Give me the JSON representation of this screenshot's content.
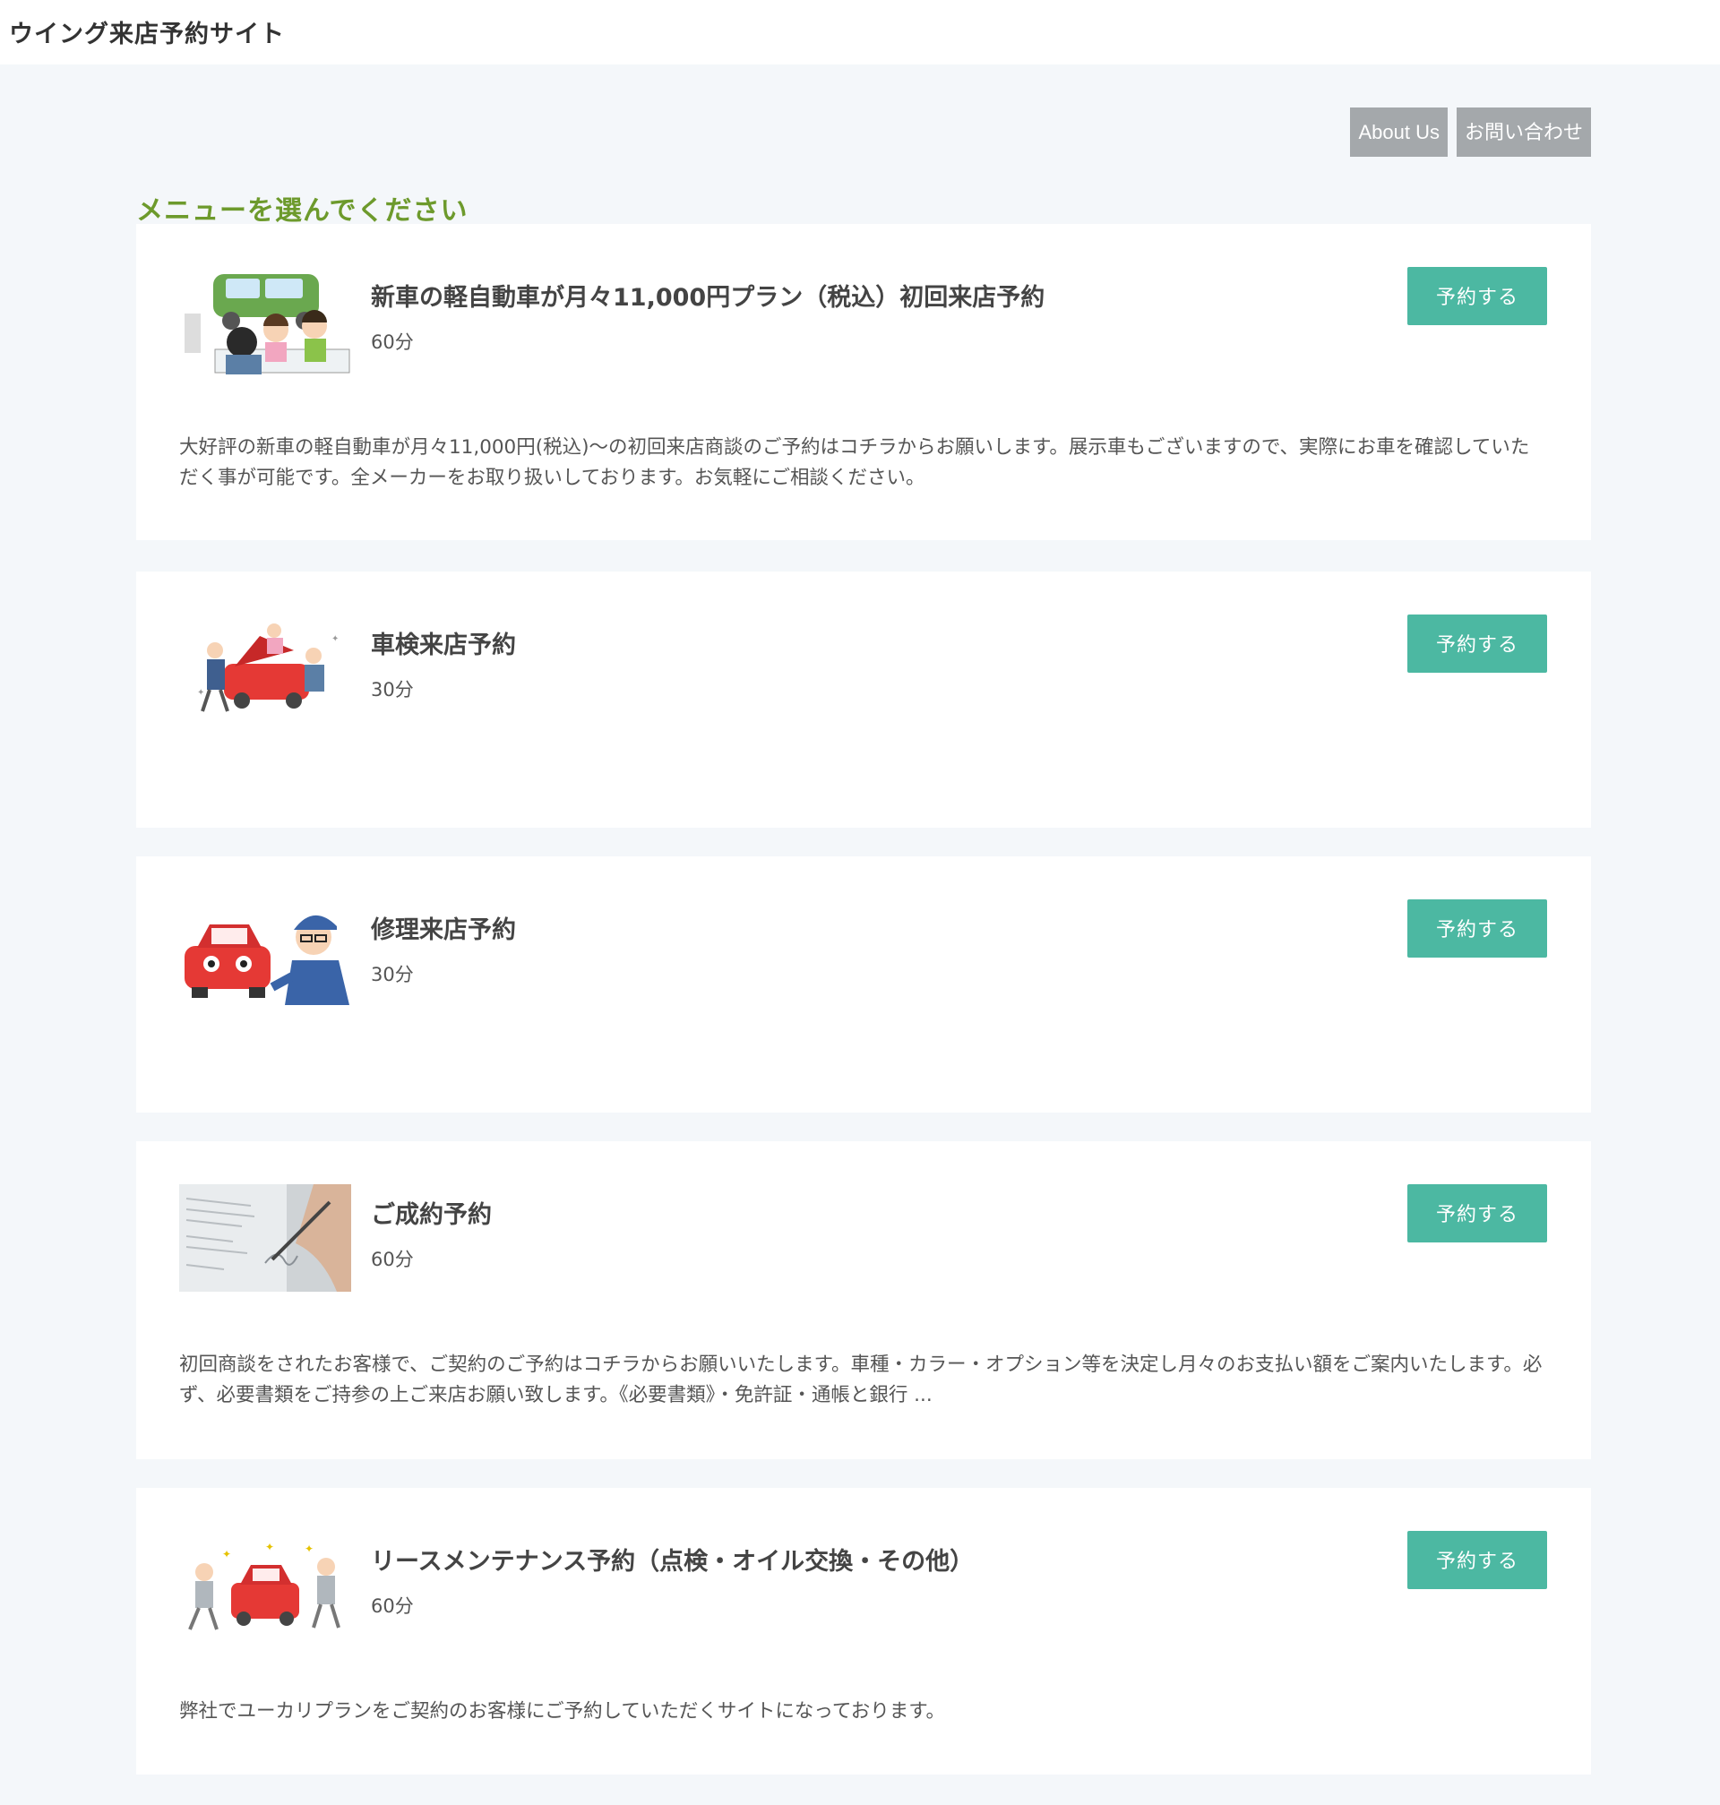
{
  "site": {
    "title": "ウイング来店予約サイト"
  },
  "nav": {
    "about": "About Us",
    "contact": "お問い合わせ"
  },
  "section": {
    "heading": "メニューを選んでください"
  },
  "colors": {
    "accent_green": "#6d9a2c",
    "button_teal": "#4cb8a2",
    "nav_gray": "#a4a8ab"
  },
  "menus": [
    {
      "title": "新車の軽自動車が月々11,000円プラン（税込）初回来店予約",
      "duration": "60分",
      "button": "予約する",
      "description": "大好評の新車の軽自動車が月々11,000円(税込)〜の初回来店商談のご予約はコチラからお願いします。展示車もございますので、実際にお車を確認していただく事が可能です。全メーカーをお取り扱いしております。お気軽にご相談ください。"
    },
    {
      "title": "車検来店予約",
      "duration": "30分",
      "button": "予約する",
      "description": ""
    },
    {
      "title": "修理来店予約",
      "duration": "30分",
      "button": "予約する",
      "description": ""
    },
    {
      "title": "ご成約予約",
      "duration": "60分",
      "button": "予約する",
      "description": "初回商談をされたお客様で、ご契約のご予約はコチラからお願いいたします。車種・カラー・オプション等を決定し月々のお支払い額をご案内いたします。必ず、必要書類をご持参の上ご来店お願い致します。《必要書類》・免許証・通帳と銀行 ..."
    },
    {
      "title": "リースメンテナンス予約（点検・オイル交換・その他）",
      "duration": "60分",
      "button": "予約する",
      "description": "弊社でユーカリプランをご契約のお客様にご予約していただくサイトになっております。"
    }
  ]
}
